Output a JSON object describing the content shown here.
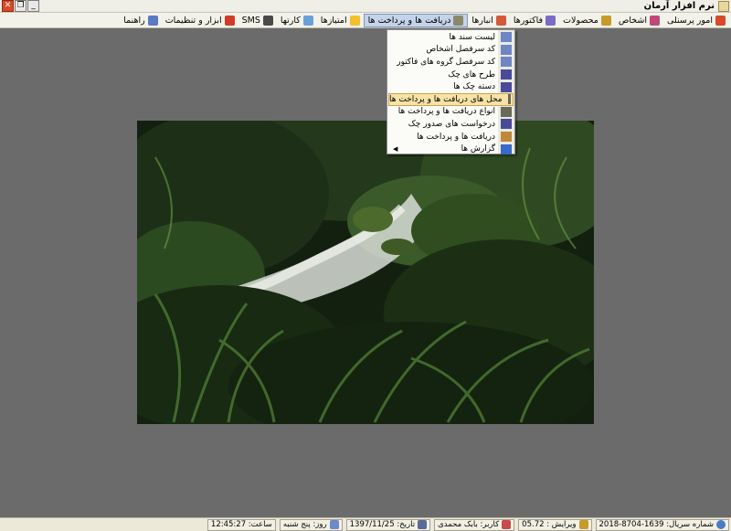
{
  "window": {
    "title": "نرم افزار آرمان"
  },
  "titlebar_buttons": {
    "minimize": "_",
    "restore": "❐",
    "close": "✕"
  },
  "menu": {
    "items": [
      {
        "label": "امور پرسنلی",
        "icon": "people-icon",
        "color": "#d94a2a"
      },
      {
        "label": "اشخاص",
        "icon": "contacts-icon",
        "color": "#c0487a"
      },
      {
        "label": "محصولات",
        "icon": "box-icon",
        "color": "#c89a2a"
      },
      {
        "label": "فاکتورها",
        "icon": "invoice-icon",
        "color": "#7a6cc8"
      },
      {
        "label": "انبارها",
        "icon": "warehouse-icon",
        "color": "#d45a3a"
      },
      {
        "label": "دریافت ها و پرداخت ها",
        "icon": "payment-icon",
        "color": "#8a8a6a",
        "active": true
      },
      {
        "label": "امتیازها",
        "icon": "star-icon",
        "color": "#f2c02a"
      },
      {
        "label": "کارتها",
        "icon": "card-icon",
        "color": "#6aa0d8"
      },
      {
        "label": "SMS",
        "icon": "sms-icon",
        "color": "#4a4a4a"
      },
      {
        "label": "ابزار و تنظیمات",
        "icon": "tools-icon",
        "color": "#d23a2a"
      },
      {
        "label": "راهنما",
        "icon": "help-icon",
        "color": "#5a7ac8"
      }
    ]
  },
  "submenu": {
    "items": [
      {
        "label": "لیست سند ها",
        "icon": "list-icon",
        "color": "#6f86c4"
      },
      {
        "label": "کد سرفصل اشخاص",
        "icon": "code-icon",
        "color": "#6f86c4"
      },
      {
        "label": "کد سرفصل گروه های فاکتور",
        "icon": "code-icon",
        "color": "#6f86c4"
      },
      {
        "label": "طرح های چک",
        "icon": "pen-icon",
        "color": "#4a4a9a"
      },
      {
        "label": "دسته چک ها",
        "icon": "pen-icon",
        "color": "#4a4a9a"
      },
      {
        "label": "محل های دریافت ها و پرداخت ها",
        "icon": "location-icon",
        "color": "#6a6a5a",
        "highlighted": true
      },
      {
        "label": "انواع دریافت ها و پرداخت ها",
        "icon": "type-icon",
        "color": "#6a6a5a"
      },
      {
        "label": "درخواست های صدور چک",
        "icon": "pen-icon",
        "color": "#4a4a9a"
      },
      {
        "label": "دریافت ها و پرداخت ها",
        "icon": "payment-icon",
        "color": "#c0883a"
      },
      {
        "label": "گزارش ها",
        "icon": "report-icon",
        "color": "#3a6ac8",
        "has_submenu": true
      }
    ]
  },
  "statusbar": {
    "serial": "شماره سریال: 1639-8704-2018",
    "version": "ویرایش : 05.72",
    "user": "کاربر: بابک محمدی",
    "date": "تاریخ: 1397/11/25",
    "day": "روز: پنج شنبه",
    "time": "ساعت: 12:45:27"
  }
}
